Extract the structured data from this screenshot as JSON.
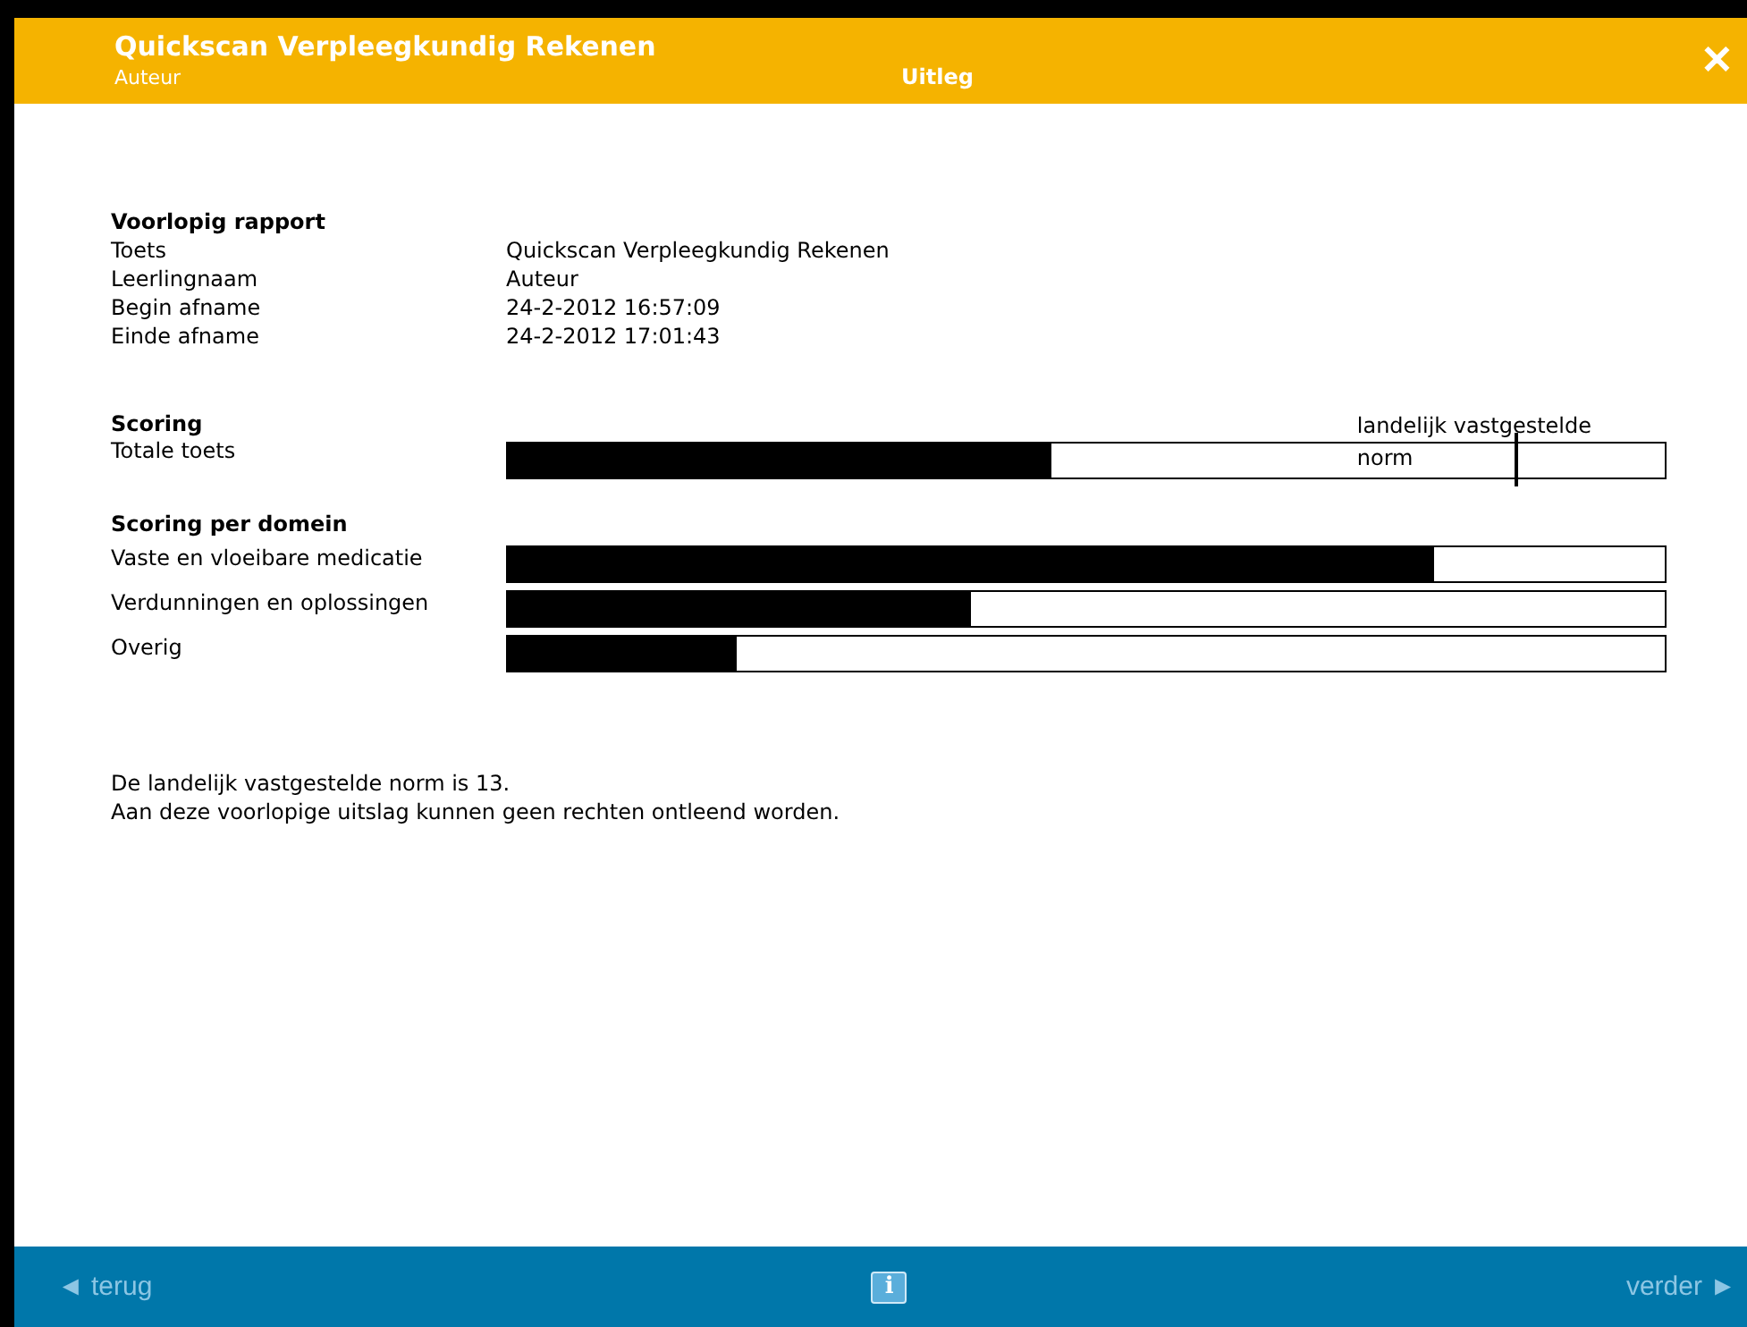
{
  "header": {
    "title": "Quickscan Verpleegkundig Rekenen",
    "user": "Auteur",
    "section": "Uitleg",
    "close": "✕"
  },
  "report": {
    "heading": "Voorlopig rapport",
    "fields": [
      {
        "label": "Toets",
        "value": "Quickscan Verpleegkundig Rekenen"
      },
      {
        "label": "Leerlingnaam",
        "value": "Auteur"
      },
      {
        "label": "Begin afname",
        "value": "24-2-2012 16:57:09"
      },
      {
        "label": "Einde afname",
        "value": "24-2-2012 17:01:43"
      }
    ]
  },
  "scoring": {
    "heading": "Scoring",
    "total": {
      "label": "Totale toets",
      "level": 0.47
    },
    "norm": {
      "label": "landelijk vastgestelde norm",
      "level": 0.87
    }
  },
  "domains": {
    "heading": "Scoring per domein",
    "items": [
      {
        "label": "Vaste en vloeibare medicatie",
        "level": 0.8
      },
      {
        "label": "Verdunningen en oplossingen",
        "level": 0.4
      },
      {
        "label": "Overig",
        "level": 0.198
      }
    ]
  },
  "notes": [
    "De landelijk vastgestelde norm is 13.",
    "Aan deze voorlopige uitslag kunnen geen rechten ontleend worden."
  ],
  "footer": {
    "back": {
      "label": "◄ terug",
      "disabled": true
    },
    "info": "i",
    "next": {
      "label": "verder ►",
      "disabled": true
    }
  }
}
